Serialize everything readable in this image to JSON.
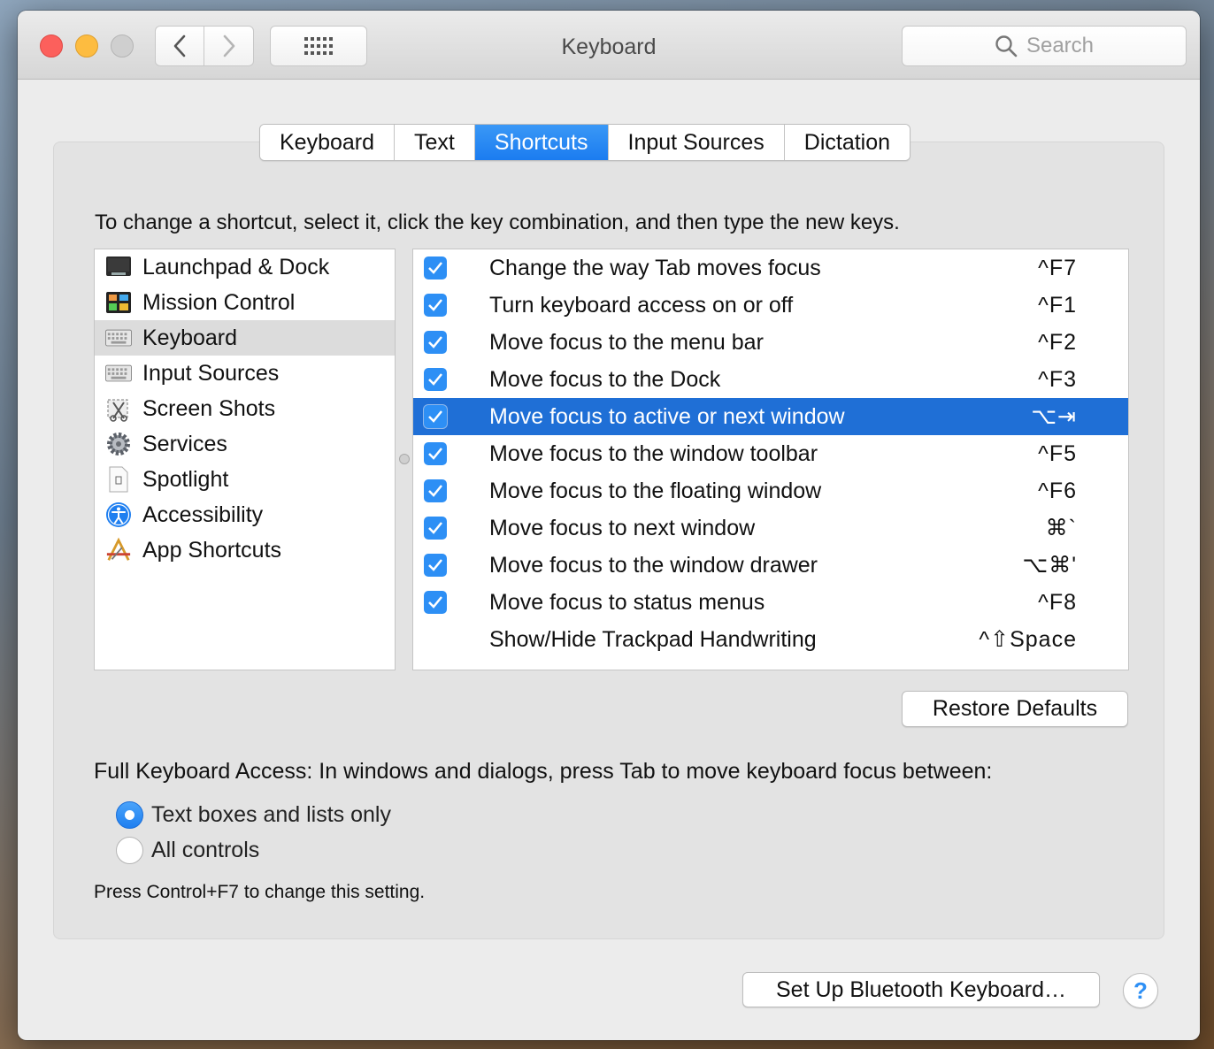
{
  "window": {
    "title": "Keyboard"
  },
  "search": {
    "placeholder": "Search"
  },
  "tabs": [
    {
      "label": "Keyboard",
      "active": false
    },
    {
      "label": "Text",
      "active": false
    },
    {
      "label": "Shortcuts",
      "active": true
    },
    {
      "label": "Input Sources",
      "active": false
    },
    {
      "label": "Dictation",
      "active": false
    }
  ],
  "instructions": "To change a shortcut, select it, click the key combination, and then type the new keys.",
  "categories": [
    {
      "label": "Launchpad & Dock",
      "icon": "launchpad-dock-icon",
      "selected": false
    },
    {
      "label": "Mission Control",
      "icon": "mission-control-icon",
      "selected": false
    },
    {
      "label": "Keyboard",
      "icon": "keyboard-icon",
      "selected": true
    },
    {
      "label": "Input Sources",
      "icon": "input-sources-icon",
      "selected": false
    },
    {
      "label": "Screen Shots",
      "icon": "screen-shots-icon",
      "selected": false
    },
    {
      "label": "Services",
      "icon": "services-gear-icon",
      "selected": false
    },
    {
      "label": "Spotlight",
      "icon": "spotlight-document-icon",
      "selected": false
    },
    {
      "label": "Accessibility",
      "icon": "accessibility-icon",
      "selected": false
    },
    {
      "label": "App Shortcuts",
      "icon": "app-shortcuts-icon",
      "selected": false
    }
  ],
  "shortcuts": [
    {
      "label": "Change the way Tab moves focus",
      "keys": "^F7",
      "checked": true,
      "selected": false
    },
    {
      "label": "Turn keyboard access on or off",
      "keys": "^F1",
      "checked": true,
      "selected": false
    },
    {
      "label": "Move focus to the menu bar",
      "keys": "^F2",
      "checked": true,
      "selected": false
    },
    {
      "label": "Move focus to the Dock",
      "keys": "^F3",
      "checked": true,
      "selected": false
    },
    {
      "label": "Move focus to active or next window",
      "keys": "⌥⇥",
      "checked": true,
      "selected": true
    },
    {
      "label": "Move focus to the window toolbar",
      "keys": "^F5",
      "checked": true,
      "selected": false
    },
    {
      "label": "Move focus to the floating window",
      "keys": "^F6",
      "checked": true,
      "selected": false
    },
    {
      "label": "Move focus to next window",
      "keys": "⌘`",
      "checked": true,
      "selected": false
    },
    {
      "label": "Move focus to the window drawer",
      "keys": "⌥⌘'",
      "checked": true,
      "selected": false
    },
    {
      "label": "Move focus to status menus",
      "keys": "^F8",
      "checked": true,
      "selected": false
    },
    {
      "label": "Show/Hide Trackpad Handwriting",
      "keys": "^⇧Space",
      "checked": false,
      "selected": false
    }
  ],
  "restore_defaults": "Restore Defaults",
  "full_keyboard_access": {
    "label": "Full Keyboard Access: In windows and dialogs, press Tab to move keyboard focus between:",
    "options": [
      {
        "label": "Text boxes and lists only",
        "selected": true
      },
      {
        "label": "All controls",
        "selected": false
      }
    ],
    "hint": "Press Control+F7 to change this setting."
  },
  "bluetooth_button": "Set Up Bluetooth Keyboard…",
  "help_button": "?",
  "colors": {
    "accent": "#1f6fd6",
    "checkbox": "#2d8ff5",
    "tab_active": "#2287f3"
  }
}
